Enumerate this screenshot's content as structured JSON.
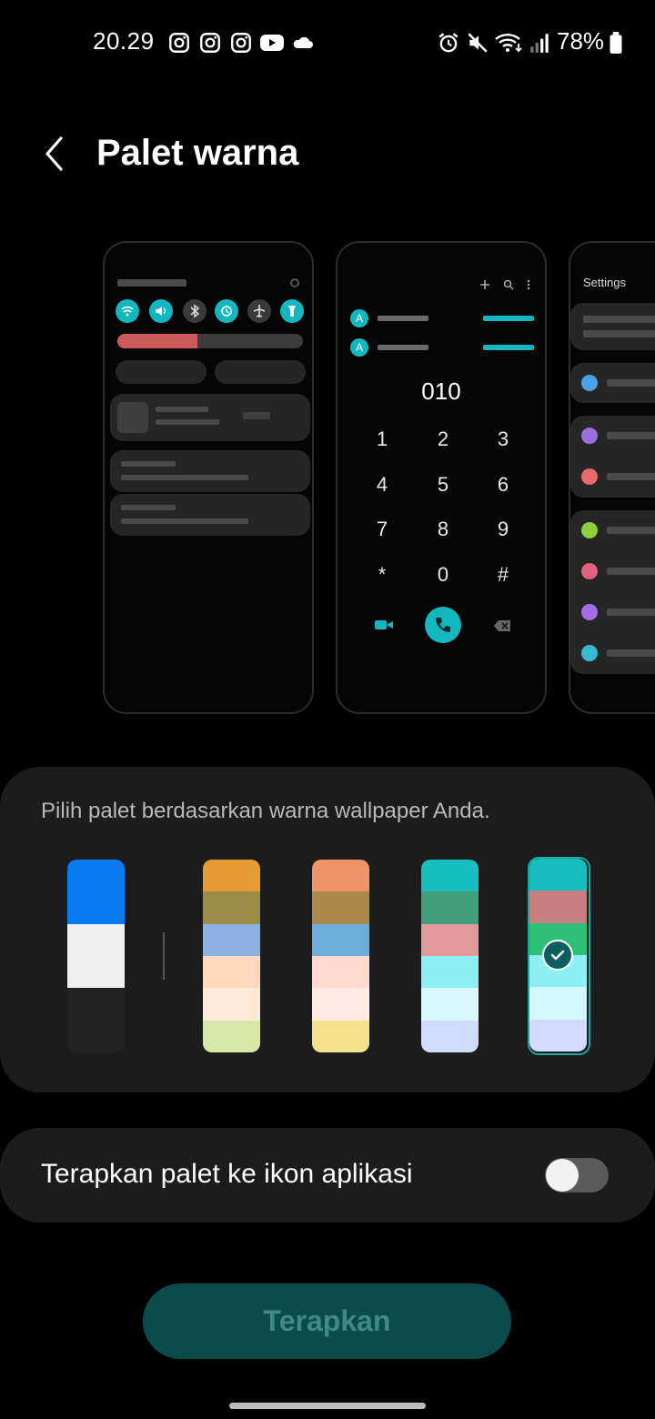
{
  "status_bar": {
    "time": "20.29",
    "battery_percent": "78%",
    "left_icons": [
      "instagram-icon",
      "instagram-icon",
      "instagram-icon",
      "youtube-icon",
      "cloud-icon"
    ],
    "right_icons": [
      "alarm-icon",
      "mute-icon",
      "wifi-icon",
      "signal-icon",
      "battery-icon"
    ]
  },
  "header": {
    "title": "Palet warna"
  },
  "preview": {
    "dialer_number": "010",
    "dialer_keys": [
      "1",
      "2",
      "3",
      "4",
      "5",
      "6",
      "7",
      "8",
      "9",
      "*",
      "0",
      "#"
    ],
    "settings_title": "Settings",
    "accent_color": "#14b7c0",
    "contacts": [
      "A",
      "A"
    ]
  },
  "palette_section": {
    "description": "Pilih palet berdasarkan warna wallpaper Anda.",
    "selected_index": 4,
    "palettes": [
      {
        "colors": [
          "#0a7af0",
          "#efefef",
          "#222222"
        ]
      },
      {
        "colors": [
          "#e59a35",
          "#9a8c45",
          "#8cb0e2",
          "#fed9be",
          "#fee9d9",
          "#d6e7a8"
        ]
      },
      {
        "colors": [
          "#ef9466",
          "#ab8a4a",
          "#6eadd9",
          "#fed9cd",
          "#ffebe2",
          "#f3e18c"
        ]
      },
      {
        "colors": [
          "#18bfc0",
          "#41a07b",
          "#e39a9a",
          "#8ef0f2",
          "#d9f8fb",
          "#cfdcfd"
        ]
      },
      {
        "colors": [
          "#16bcbf",
          "#c77e7e",
          "#2fbf79",
          "#8ef0f2",
          "#d4f7fb",
          "#d2dcfd"
        ]
      }
    ]
  },
  "icon_toggle": {
    "label": "Terapkan palet ke ikon aplikasi",
    "enabled": false
  },
  "apply_button": {
    "label": "Terapkan"
  }
}
